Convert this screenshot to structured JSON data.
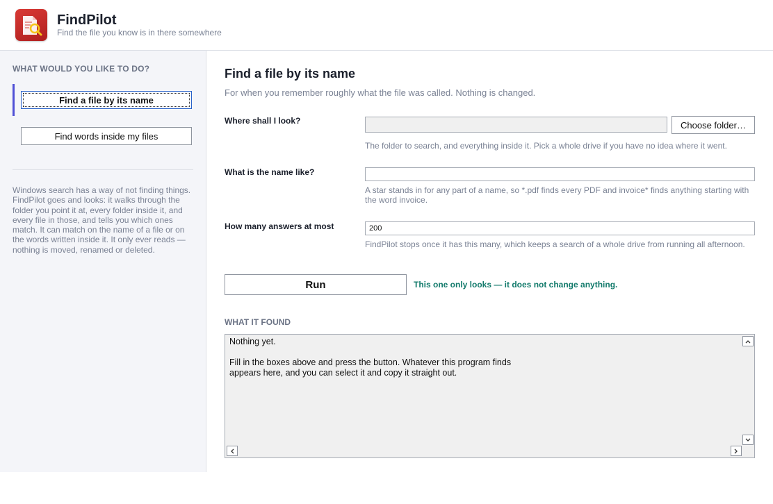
{
  "app": {
    "title": "FindPilot",
    "subtitle": "Find the file you know is in there somewhere",
    "logo_icon": "document-search-icon",
    "brand_color": "#c62828"
  },
  "sidebar": {
    "heading": "WHAT WOULD YOU LIKE TO DO?",
    "items": [
      {
        "label": "Find a file by its name",
        "selected": true
      },
      {
        "label": "Find words inside my files",
        "selected": false
      }
    ],
    "accent_color": "#4f4fd6",
    "description": "Windows search has a way of not finding things. FindPilot goes and looks: it walks through the folder you point it at, every folder inside it, and every file in those, and tells you which ones match. It can match on the name of a file or on the words written inside it. It only ever reads — nothing is moved, renamed or deleted."
  },
  "main": {
    "title": "Find a file by its name",
    "subtitle": "For when you remember roughly what the file was called. Nothing is changed.",
    "fields": {
      "folder": {
        "label": "Where shall I look?",
        "value": "",
        "button_label": "Choose folder…",
        "hint": "The folder to search, and everything inside it. Pick a whole drive if you have no idea where it went."
      },
      "name": {
        "label": "What is the name like?",
        "value": "",
        "hint": "A star stands in for any part of a name, so *.pdf finds every PDF and invoice* finds anything starting with the word invoice."
      },
      "max": {
        "label": "How many answers at most",
        "value": "200",
        "hint": "FindPilot stops once it has this many, which keeps a search of a whole drive from running all afternoon."
      }
    },
    "run_label": "Run",
    "safety_note": "This one only looks — it does not change anything.",
    "safety_color": "#127a6b",
    "results": {
      "heading": "WHAT IT FOUND",
      "text": "Nothing yet.\n\nFill in the boxes above and press the button. Whatever this program finds\nappears here, and you can select it and copy it straight out."
    }
  }
}
